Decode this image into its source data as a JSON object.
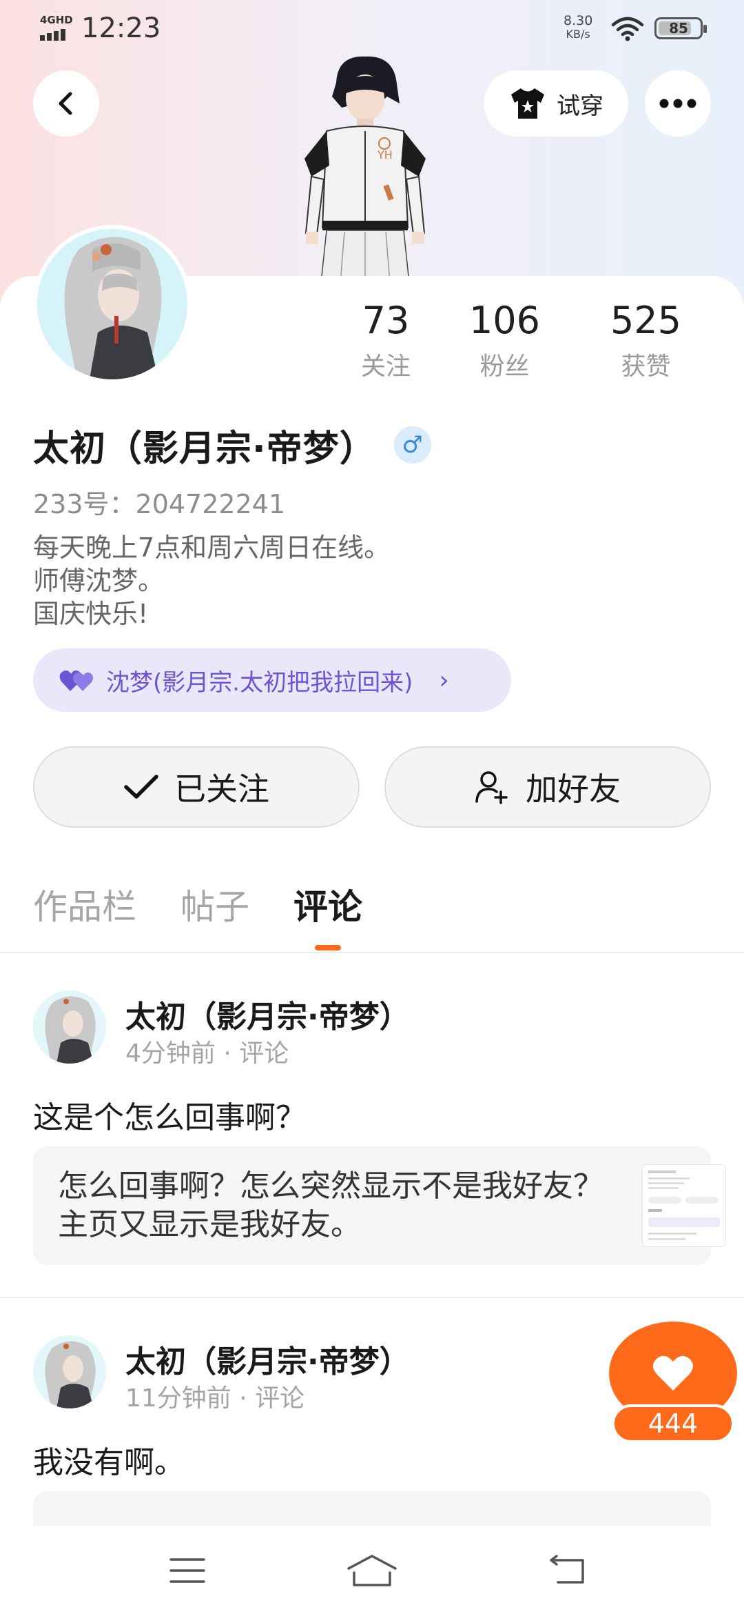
{
  "status_bar": {
    "network": "4GHD",
    "time": "12:23",
    "speed_value": "8.30",
    "speed_unit": "KB/s",
    "battery": "85"
  },
  "header": {
    "back_icon": "chevron-left-icon",
    "try_on_label": "试穿",
    "try_on_icon": "tshirt-icon",
    "more_icon": "ellipsis-icon"
  },
  "profile": {
    "stats": [
      {
        "value": "73",
        "label": "关注"
      },
      {
        "value": "106",
        "label": "粉丝"
      },
      {
        "value": "525",
        "label": "获赞"
      }
    ],
    "name": "太初（影月宗·帝梦）",
    "gender_symbol": "♂",
    "uid": "233号：204722241",
    "bio_lines": [
      "每天晚上7点和周六周日在线。",
      "师傅沈梦。",
      "国庆快乐!"
    ],
    "mentor_label": "沈梦(影月宗.太初把我拉回来)",
    "follow_label": "已关注",
    "add_friend_label": "加好友"
  },
  "tabs": [
    {
      "label": "作品栏",
      "active": false
    },
    {
      "label": "帖子",
      "active": false
    },
    {
      "label": "评论",
      "active": true
    }
  ],
  "posts": [
    {
      "author": "太初（影月宗·帝梦）",
      "meta": "4分钟前 · 评论",
      "text": "这是个怎么回事啊？",
      "quote": "怎么回事啊？怎么突然显示不是我好友？主页又显示是我好友。"
    },
    {
      "author": "太初（影月宗·帝梦）",
      "meta": "11分钟前 · 评论",
      "text": "我没有啊。",
      "quote": ""
    }
  ],
  "like_count": "444",
  "colors": {
    "accent": "#ff6a1a",
    "mentor_purple": "#6b54d6",
    "mentor_bg": "#ebe7fb",
    "gender_blue": "#3a8ad8"
  }
}
